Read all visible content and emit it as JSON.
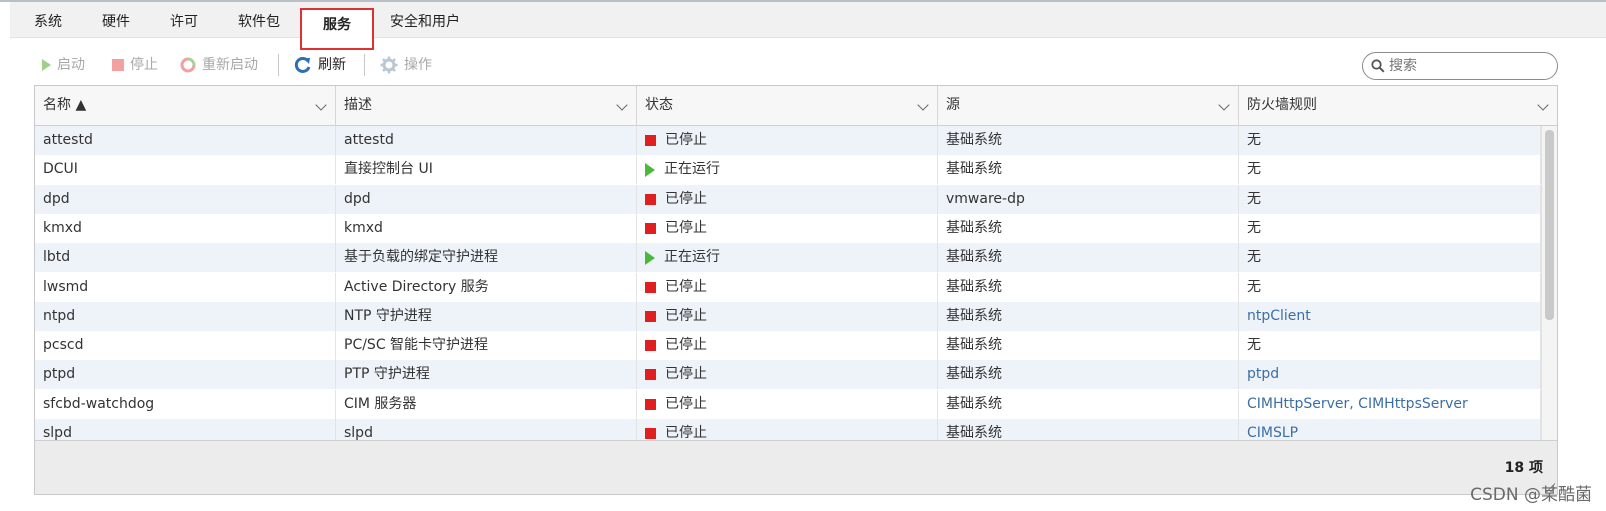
{
  "tabs": [
    {
      "label": "系统"
    },
    {
      "label": "硬件"
    },
    {
      "label": "许可"
    },
    {
      "label": "软件包"
    },
    {
      "label": "服务",
      "active": true
    },
    {
      "label": "安全和用户"
    }
  ],
  "toolbar": {
    "start_label": "启动",
    "stop_label": "停止",
    "restart_label": "重新启动",
    "refresh_label": "刷新",
    "actions_label": "操作"
  },
  "search": {
    "placeholder": "搜索"
  },
  "columns": [
    "名称 ▲",
    "描述",
    "状态",
    "源",
    "防火墙规则"
  ],
  "rows": [
    {
      "name": "attestd",
      "desc": "attestd",
      "status": "已停止",
      "state": "stopped",
      "source": "基础系统",
      "firewall": "无",
      "fw_link": false
    },
    {
      "name": "DCUI",
      "desc": "直接控制台 UI",
      "status": "正在运行",
      "state": "running",
      "source": "基础系统",
      "firewall": "无",
      "fw_link": false
    },
    {
      "name": "dpd",
      "desc": "dpd",
      "status": "已停止",
      "state": "stopped",
      "source": "vmware-dp",
      "firewall": "无",
      "fw_link": false
    },
    {
      "name": "kmxd",
      "desc": "kmxd",
      "status": "已停止",
      "state": "stopped",
      "source": "基础系统",
      "firewall": "无",
      "fw_link": false
    },
    {
      "name": "lbtd",
      "desc": "基于负载的绑定守护进程",
      "status": "正在运行",
      "state": "running",
      "source": "基础系统",
      "firewall": "无",
      "fw_link": false
    },
    {
      "name": "lwsmd",
      "desc": "Active Directory 服务",
      "status": "已停止",
      "state": "stopped",
      "source": "基础系统",
      "firewall": "无",
      "fw_link": false
    },
    {
      "name": "ntpd",
      "desc": "NTP 守护进程",
      "status": "已停止",
      "state": "stopped",
      "source": "基础系统",
      "firewall": "ntpClient",
      "fw_link": true
    },
    {
      "name": "pcscd",
      "desc": "PC/SC 智能卡守护进程",
      "status": "已停止",
      "state": "stopped",
      "source": "基础系统",
      "firewall": "无",
      "fw_link": false
    },
    {
      "name": "ptpd",
      "desc": "PTP 守护进程",
      "status": "已停止",
      "state": "stopped",
      "source": "基础系统",
      "firewall": "ptpd",
      "fw_link": true
    },
    {
      "name": "sfcbd-watchdog",
      "desc": "CIM 服务器",
      "status": "已停止",
      "state": "stopped",
      "source": "基础系统",
      "firewall": "CIMHttpServer, CIMHttpsServer",
      "fw_link": true
    },
    {
      "name": "slpd",
      "desc": "slpd",
      "status": "已停止",
      "state": "stopped",
      "source": "基础系统",
      "firewall": "CIMSLP",
      "fw_link": true
    }
  ],
  "footer": {
    "count": "18 项"
  },
  "watermark": "CSDN @某酷菌",
  "colors": {
    "accent": "#3c6ea6",
    "stopped": "#e02020",
    "running": "#4cb83a",
    "highlight_border": "#e03030"
  }
}
